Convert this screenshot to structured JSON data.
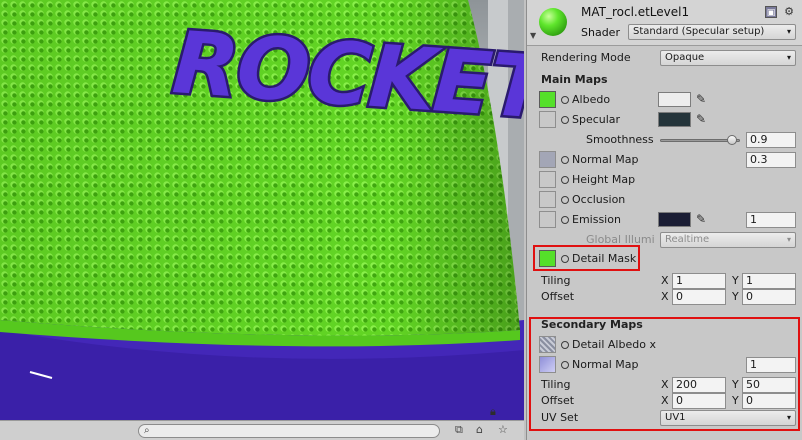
{
  "material": {
    "name": "MAT_rocl.etLevel1",
    "shader_label": "Shader",
    "shader_value": "Standard (Specular setup)"
  },
  "scene": {
    "text": "ROCKET",
    "colors": {
      "green": "#6fe32d",
      "purple": "#4b2fc0",
      "outline": "#2a1a6e"
    }
  },
  "rendering_mode": {
    "label": "Rendering Mode",
    "value": "Opaque"
  },
  "main_maps": {
    "title": "Main Maps",
    "albedo": "Albedo",
    "specular": "Specular",
    "smoothness": {
      "label": "Smoothness",
      "value": "0.9"
    },
    "normal_map": {
      "label": "Normal Map",
      "value": "0.3"
    },
    "height_map": "Height Map",
    "occlusion": "Occlusion",
    "emission": {
      "label": "Emission",
      "value": "1"
    },
    "global_illum": {
      "label": "Global Illumi",
      "value": "Realtime"
    },
    "detail_mask": "Detail Mask",
    "tiling": {
      "label": "Tiling",
      "x": "1",
      "y": "1"
    },
    "offset": {
      "label": "Offset",
      "x": "0",
      "y": "0"
    }
  },
  "secondary_maps": {
    "title": "Secondary Maps",
    "detail_albedo": "Detail Albedo x",
    "normal_map": {
      "label": "Normal Map",
      "value": "1"
    },
    "tiling": {
      "label": "Tiling",
      "x": "200",
      "y": "50"
    },
    "offset": {
      "label": "Offset",
      "x": "0",
      "y": "0"
    },
    "uv_set": {
      "label": "UV Set",
      "value": "UV1"
    }
  },
  "axis": {
    "x": "X",
    "y": "Y"
  },
  "highlight_color": "#e01010"
}
